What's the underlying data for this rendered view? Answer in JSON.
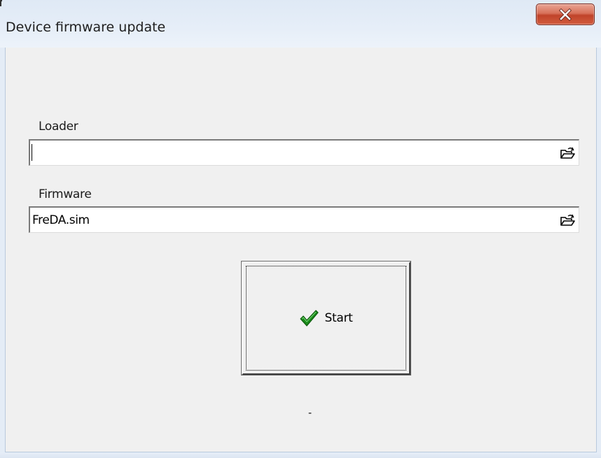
{
  "window": {
    "title": "Device firmware update",
    "close_label": "X"
  },
  "loader": {
    "label": "Loader",
    "value": ""
  },
  "firmware": {
    "label": "Firmware",
    "value": "FreDA.sim"
  },
  "start": {
    "label": "Start",
    "icon": "checkmark-icon"
  },
  "status": {
    "text": "-"
  },
  "colors": {
    "close_red": "#c0432a",
    "dialog_bg": "#f0f0f0",
    "check_green": "#1a8a1a"
  }
}
